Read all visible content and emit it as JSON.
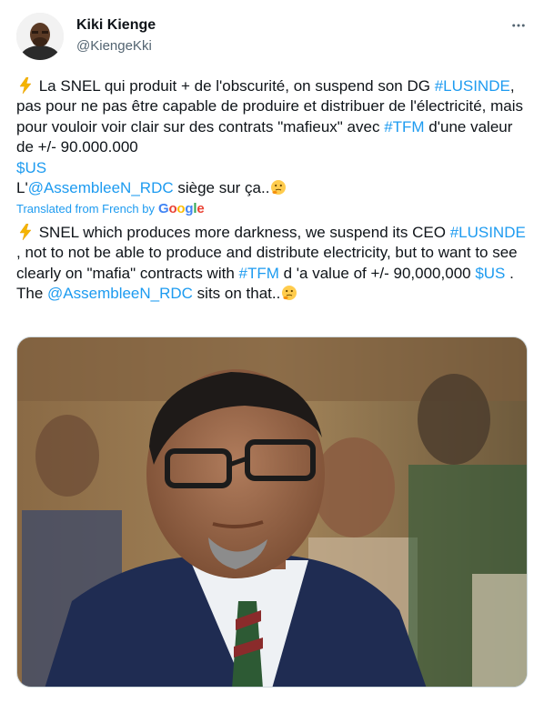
{
  "author": {
    "display_name": "Kiki Kienge",
    "handle": "@KiengeKki"
  },
  "icons": {
    "more": "more-horizontal-icon",
    "lightning": "high-voltage-emoji",
    "thinking": "thinking-face-emoji"
  },
  "tweet_fr": {
    "line1_text": " La SNEL qui produit + de l'obscurité, on suspend son DG ",
    "hashtag_lusinde": "#LUSINDE",
    "line2_text": ", pas pour ne pas être capable de produire et distribuer de l'électricité, mais pour vouloir voir clair sur des contrats \"mafieux\" avec ",
    "hashtag_tfm": "#TFM",
    "line3_text": " d'une valeur de +/- 90.000.000 ",
    "cashtag_us": "$US",
    "line4_prefix": "L'",
    "mention": "@AssembleeN_RDC",
    "line4_text": " siège sur ça.."
  },
  "translation": {
    "label": "Translated from French by",
    "provider": "Google"
  },
  "tweet_en": {
    "line1_text": " SNEL which produces more darkness, we suspend its CEO ",
    "hashtag_lusinde": "#LUSINDE",
    "line2_text": " , not to not be able to produce and distribute electricity, but to want to see clearly on \"mafia\" contracts with ",
    "hashtag_tfm": "#TFM",
    "line3_text": " d 'a value of +/- 90,000,000 ",
    "cashtag_us": "$US",
    "line3_end": " .",
    "line4_prefix": "The ",
    "mention": "@AssembleeN_RDC",
    "line4_text": " sits on that.."
  },
  "colors": {
    "link": "#1d9bf0",
    "text": "#0f1419",
    "secondary": "#536471"
  }
}
